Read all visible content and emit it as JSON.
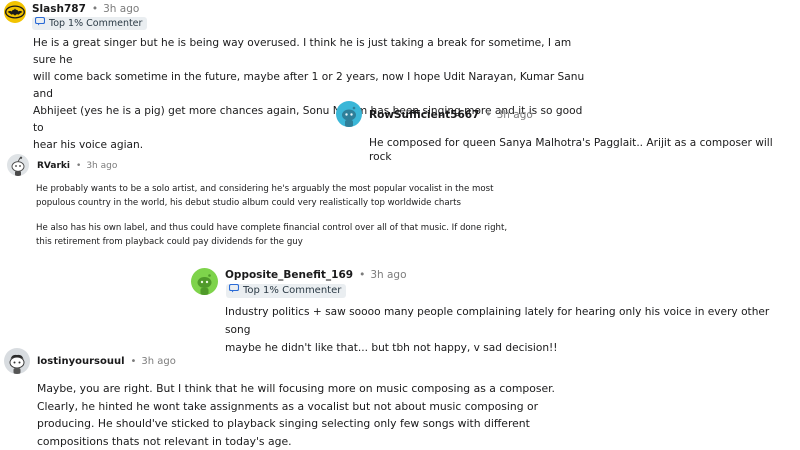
{
  "comments": [
    {
      "username": "Slash787",
      "time": "3h ago",
      "badge": "Top 1% Commenter",
      "avatar_icon": "batman-logo-avatar-icon",
      "lines": [
        "He is a great singer but he is being way overused. I think he is just taking a break for sometime, I am sure he",
        "will come back sometime in the future, maybe after 1 or 2 years, now I hope Udit Narayan, Kumar Sanu and",
        "Abhijeet (yes he is a pig) get more chances again, Sonu Nigam has been singing more and it is so good to",
        "hear his voice agian."
      ]
    },
    {
      "username": "RowSufficient5667",
      "time": "3h ago",
      "avatar_icon": "snoo-avatar-icon",
      "avatar_color": "#3ab7d8",
      "lines": [
        "He composed for queen Sanya Malhotra's Pagglait.. Arijit as a composer will rock"
      ]
    },
    {
      "username": "RVarki",
      "time": "3h ago",
      "avatar_icon": "snoo-avatar-icon",
      "paragraphs": [
        [
          "He probably wants to be a solo artist, and considering he's arguably the most popular vocalist in the most",
          "populous country in the world, his debut studio album could very realistically top worldwide charts"
        ],
        [
          "He also has his own label, and thus could have complete financial control over all of that music. If done right,",
          "this retirement from playback could pay dividends for the guy"
        ]
      ]
    },
    {
      "username": "Opposite_Benefit_169",
      "time": "3h ago",
      "badge": "Top 1% Commenter",
      "avatar_icon": "snoo-avatar-icon",
      "avatar_color": "#7ed34b",
      "lines": [
        "Industry politics + saw soooo many people complaining lately for hearing only his voice in every other song",
        "maybe he didn't like that... but tbh not happy, v sad decision!!"
      ]
    },
    {
      "username": "lostinyoursouul",
      "time": "3h ago",
      "avatar_icon": "snoo-avatar-icon",
      "lines": [
        "Maybe, you are right. But I think that he will focusing more on music composing as a composer.",
        "Clearly, he hinted he wont take assignments as a vocalist but not about music composing or",
        "producing. He should've sticked to playback singing selecting only few songs with different",
        "compositions thats not relevant in today's age."
      ]
    }
  ],
  "separator": "•",
  "badge_icon": "comment-badge-icon"
}
